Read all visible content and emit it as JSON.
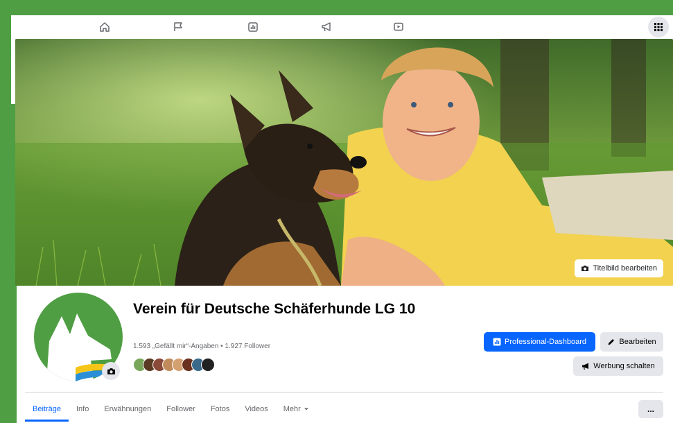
{
  "page": {
    "name": "Verein für Deutsche Schäferhunde LG 10",
    "stats": "1.593 „Gefällt mir“-Angaben • 1.927 Follower"
  },
  "nav": {
    "icons": [
      "home-icon",
      "flag-icon",
      "insights-icon",
      "megaphone-icon",
      "video-icon"
    ],
    "menu_icon": "grid-menu-icon"
  },
  "cover": {
    "edit_label": "Titelbild bearbeiten"
  },
  "actions": {
    "dashboard_label": "Professional-Dashboard",
    "edit_label": "Bearbeiten",
    "ads_label": "Werbung schalten"
  },
  "tabs": [
    {
      "label": "Beiträge",
      "active": true
    },
    {
      "label": "Info"
    },
    {
      "label": "Erwähnungen"
    },
    {
      "label": "Follower"
    },
    {
      "label": "Fotos"
    },
    {
      "label": "Videos"
    },
    {
      "label": "Mehr"
    }
  ],
  "more_button": "...",
  "colors": {
    "accent": "#0866ff",
    "frame_green": "#4f9e43",
    "button_grey": "#e4e6eb",
    "logo_yellow": "#f5c518",
    "logo_blue": "#2a8fd6"
  }
}
